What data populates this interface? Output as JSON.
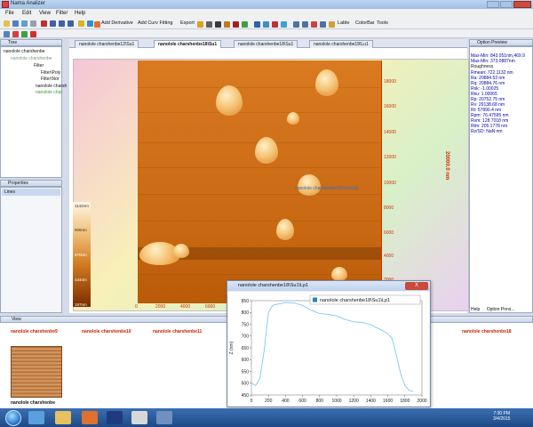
{
  "window": {
    "title": "Nama Analizer"
  },
  "menu": [
    "File",
    "Edit",
    "View",
    "Filter",
    "Help"
  ],
  "toolbar2": {
    "add_derivative": "Add Derivative",
    "add_curv_fitting": "Add Curv Fitting",
    "export": "Export",
    "lable": "Lable",
    "colorbar": "ColorBar",
    "tools": "Tools"
  },
  "tree": {
    "title": "Tree",
    "items": [
      "nanolole charshenbe",
      "nanolole charshenbe",
      "Filter",
      "Filter\\Poly",
      "Filter\\Nor",
      "nanolole charsh",
      "nanolole char"
    ]
  },
  "properties": {
    "title": "Properties",
    "lines_label": "Lines"
  },
  "doc_tabs": [
    "nanolole charshenbe12\\Su1",
    "nanolole charshenbe18\\Su1",
    "nanolole charshenbe18\\Su1",
    "nanolole charshenbe18\\Lu1"
  ],
  "afm": {
    "x_ticks": [
      "0",
      "2000",
      "4000",
      "6000"
    ],
    "y_ticks": [
      "18000",
      "16000",
      "14000",
      "12000",
      "10000",
      "8000",
      "6000",
      "4000",
      "2000"
    ],
    "axis_title": "20000.0 nm",
    "annotation": "nanolole charshenbe18\\Su1\\Lp1",
    "colorbar_labels": [
      "1142nm",
      "906nm",
      "670nm",
      "434nm",
      "197nm"
    ]
  },
  "option_preview": {
    "title": "Option Preview",
    "rows": [
      "Max-Min: 843.051nm,469.9",
      "Max-Min: 373.0887nm",
      "Roughness",
      "Rmean: 722.1132 nm",
      "Ra: 20884.53 nm",
      "Rq: 20884.76 nm",
      "Rsk: -1.00025",
      "Rku: 1.00065",
      "Rp: 20752.75 nm",
      "Rv: 29138.68 nm",
      "Rt: 57890.4 nm",
      "Rpm: 76.47595 nm",
      "Rvm: 128.7018 nm",
      "Rtm: 205.1778 nm",
      "Rz/SD: NaN nm"
    ],
    "help": "Help",
    "tab_label": "Option Previ..."
  },
  "plot": {
    "window_title": "nanolole charshenbe18\\Su1\\Lp1",
    "legend": "nanolole charshenbe18\\Su1\\Lp1",
    "ylabel": "Z (nm)",
    "close": "X"
  },
  "chart_data": {
    "type": "line",
    "x": [
      0,
      50,
      100,
      150,
      200,
      250,
      300,
      350,
      400,
      500,
      600,
      700,
      800,
      900,
      1000,
      1100,
      1200,
      1300,
      1400,
      1500,
      1600,
      1650,
      1700,
      1750,
      1800,
      1850,
      1900
    ],
    "series": [
      {
        "name": "nanolole charshenbe18\\Su1\\Lp1",
        "values": [
          500,
          490,
          520,
          640,
          800,
          830,
          835,
          838,
          842,
          840,
          830,
          810,
          795,
          792,
          785,
          770,
          760,
          758,
          748,
          730,
          710,
          690,
          620,
          540,
          490,
          470,
          465
        ]
      }
    ],
    "xlim": [
      0,
      2000
    ],
    "ylim": [
      450,
      850
    ],
    "x_ticks": [
      0,
      200,
      400,
      600,
      800,
      1000,
      1200,
      1400,
      1600,
      1800,
      2000
    ],
    "y_ticks": [
      450,
      500,
      550,
      600,
      650,
      700,
      750,
      800,
      850
    ],
    "ylabel": "Z (nm)",
    "grid": false,
    "legend": "top-center"
  },
  "view": {
    "title": "View",
    "thumbs": [
      "nanolole charshenbe9",
      "nanolole charshenbe10",
      "nanolole charshenbe11",
      "nanolole charshenbe18"
    ],
    "thumb_caption": "nanolole charshenbe"
  },
  "taskbar": {
    "time": "7:30 PM",
    "date": "3/4/2015"
  }
}
